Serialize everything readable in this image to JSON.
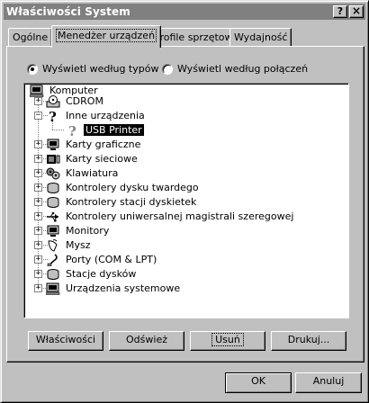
{
  "window": {
    "title": "Właściwości System"
  },
  "titlebar_buttons": {
    "help": "?",
    "close": "×"
  },
  "tabs": [
    {
      "label": "Ogólne",
      "active": false
    },
    {
      "label": "Menedżer urządzeń",
      "active": true
    },
    {
      "label": "Profile sprzętowe",
      "active": false
    },
    {
      "label": "Wydajność",
      "active": false
    }
  ],
  "view_options": {
    "by_type": {
      "label": "Wyświetl według typów",
      "selected": true
    },
    "by_connection": {
      "label": "Wyświetl według połączeń",
      "selected": false
    }
  },
  "tree": [
    {
      "label": "Komputer",
      "icon": "computer-icon",
      "level": 0,
      "expander": ""
    },
    {
      "label": "CDROM",
      "icon": "cdrom-icon",
      "level": 1,
      "expander": "+"
    },
    {
      "label": "Inne urządzenia",
      "icon": "question-icon",
      "level": 1,
      "expander": "−"
    },
    {
      "label": "USB Printer",
      "icon": "question-icon",
      "level": 2,
      "expander": "",
      "selected": true
    },
    {
      "label": "Karty graficzne",
      "icon": "monitor-icon",
      "level": 1,
      "expander": "+"
    },
    {
      "label": "Karty sieciowe",
      "icon": "network-card-icon",
      "level": 1,
      "expander": "+"
    },
    {
      "label": "Klawiatura",
      "icon": "keyboard-icon",
      "level": 1,
      "expander": "+"
    },
    {
      "label": "Kontrolery dysku twardego",
      "icon": "disk-controller-icon",
      "level": 1,
      "expander": "+"
    },
    {
      "label": "Kontrolery stacji dyskietek",
      "icon": "floppy-controller-icon",
      "level": 1,
      "expander": "+"
    },
    {
      "label": "Kontrolery uniwersalnej magistrali szeregowej",
      "icon": "usb-icon",
      "level": 1,
      "expander": "+"
    },
    {
      "label": "Monitory",
      "icon": "monitor-icon",
      "level": 1,
      "expander": "+"
    },
    {
      "label": "Mysz",
      "icon": "mouse-icon",
      "level": 1,
      "expander": "+"
    },
    {
      "label": "Porty (COM & LPT)",
      "icon": "port-icon",
      "level": 1,
      "expander": "+"
    },
    {
      "label": "Stacje dysków",
      "icon": "drive-icon",
      "level": 1,
      "expander": "+"
    },
    {
      "label": "Urządzenia systemowe",
      "icon": "system-device-icon",
      "level": 1,
      "expander": "+"
    }
  ],
  "panel_buttons": {
    "properties": "Właściwości",
    "refresh": "Odśwież",
    "remove": "Usuń",
    "print": "Drukuj..."
  },
  "dialog_buttons": {
    "ok": "OK",
    "cancel": "Anuluj"
  }
}
